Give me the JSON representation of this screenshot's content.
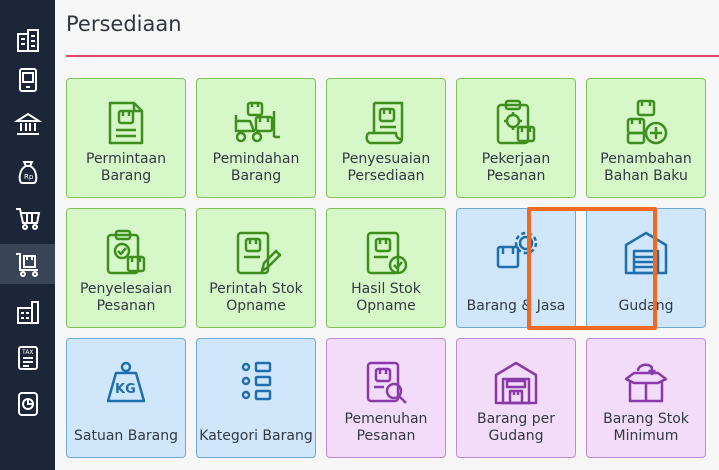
{
  "page": {
    "title": "Persediaan"
  },
  "sidebar": {
    "icons": [
      "buildings-icon",
      "tablet-icon",
      "bank-icon",
      "money-bag-icon",
      "shopping-cart-icon",
      "inventory-cart-icon",
      "factory-icon",
      "tax-icon",
      "report-icon"
    ],
    "active_index": 5
  },
  "tiles": [
    {
      "label": "Permintaan\nBarang",
      "color": "green",
      "icon": "request-document-icon"
    },
    {
      "label": "Pemindahan\nBarang",
      "color": "green",
      "icon": "forklift-icon"
    },
    {
      "label": "Penyesuaian\nPersediaan",
      "color": "green",
      "icon": "adjustment-scroll-icon"
    },
    {
      "label": "Pekerjaan\nPesanan",
      "color": "green",
      "icon": "work-order-clipboard-icon"
    },
    {
      "label": "Penambahan\nBahan Baku",
      "color": "green",
      "icon": "add-raw-material-icon"
    },
    {
      "label": "Penyelesaian\nPesanan",
      "color": "green",
      "icon": "order-completion-clipboard-icon"
    },
    {
      "label": "Perintah Stok\nOpname",
      "color": "green",
      "icon": "stock-opname-order-icon"
    },
    {
      "label": "Hasil Stok\nOpname",
      "color": "green",
      "icon": "stock-opname-result-icon"
    },
    {
      "label": "Barang & Jasa",
      "color": "blue",
      "icon": "goods-services-gear-icon"
    },
    {
      "label": "Gudang",
      "color": "blue",
      "icon": "warehouse-icon"
    },
    {
      "label": "Satuan Barang",
      "color": "blue",
      "icon": "kg-weight-icon"
    },
    {
      "label": "Kategori Barang",
      "color": "blue",
      "icon": "category-list-icon"
    },
    {
      "label": "Pemenuhan\nPesanan",
      "color": "purple",
      "icon": "order-fulfillment-search-icon"
    },
    {
      "label": "Barang per\nGudang",
      "color": "purple",
      "icon": "goods-per-warehouse-icon"
    },
    {
      "label": "Barang Stok\nMinimum",
      "color": "purple",
      "icon": "minimum-stock-box-icon"
    }
  ],
  "colors": {
    "green_icon": "#3f8f1f",
    "blue_icon": "#1f6fae",
    "purple_icon": "#8a3aa8",
    "highlight": "#f06a23",
    "accent_rule": "#e0486b"
  }
}
